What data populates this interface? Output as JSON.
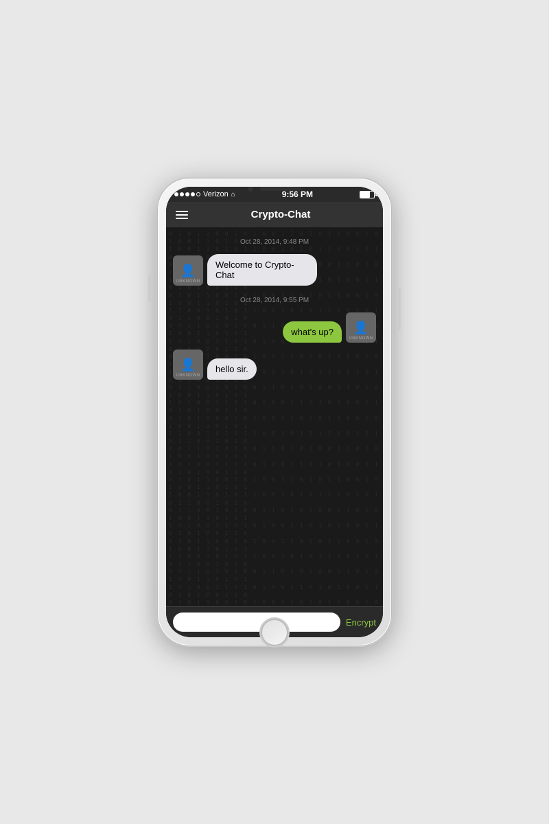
{
  "status_bar": {
    "carrier": "Verizon",
    "time": "9:56 PM",
    "wifi_icon": "📶"
  },
  "nav": {
    "title": "Crypto-Chat",
    "menu_icon": "hamburger"
  },
  "messages": [
    {
      "type": "timestamp",
      "text": "Oct 28, 2014, 9:48 PM"
    },
    {
      "type": "received",
      "avatar_label": "UNKNOWN",
      "text": "Welcome to Crypto-Chat"
    },
    {
      "type": "timestamp",
      "text": "Oct 28, 2014, 9:55 PM"
    },
    {
      "type": "sent",
      "avatar_label": "UNKNOWN",
      "text": "what's up?"
    },
    {
      "type": "received",
      "avatar_label": "UNKNOWN",
      "text": "hello sir."
    }
  ],
  "input": {
    "placeholder": "",
    "encrypt_label": "Encrypt"
  }
}
